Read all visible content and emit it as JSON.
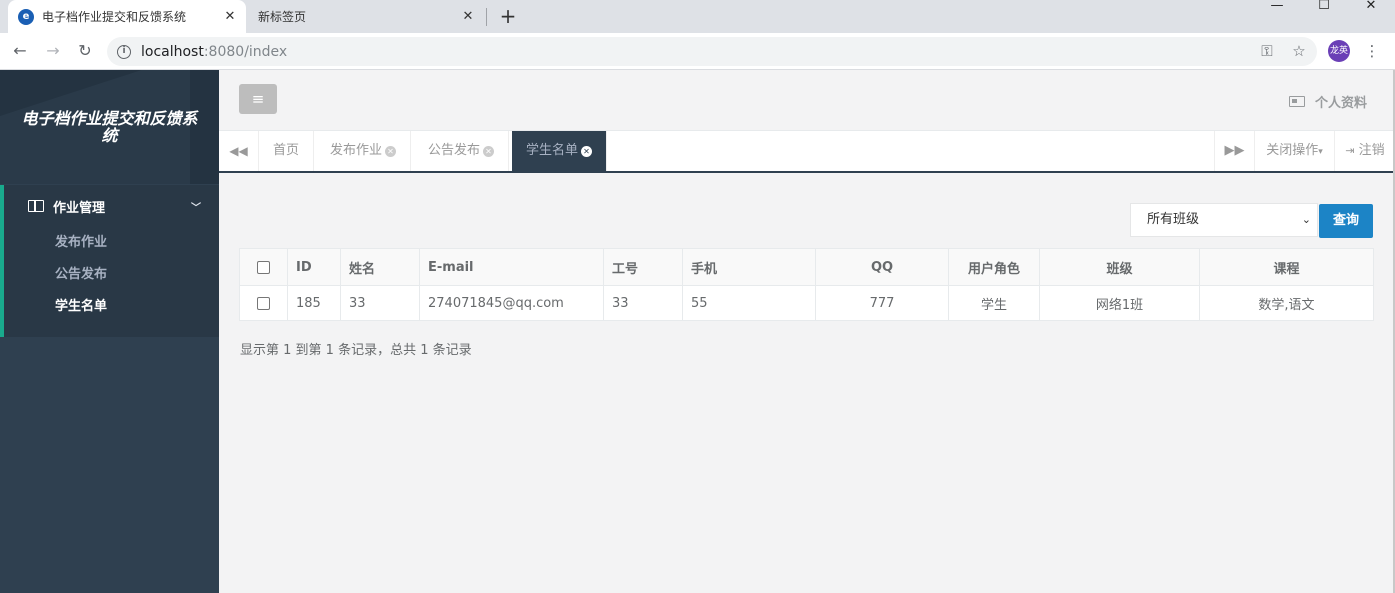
{
  "browser": {
    "tabs": [
      {
        "title": "电子档作业提交和反馈系统",
        "active": true
      },
      {
        "title": "新标签页",
        "active": false
      }
    ],
    "url_host": "localhost",
    "url_path": ":8080/index",
    "profile_text": "龙英"
  },
  "sidebar": {
    "brand": "电子档作业提交和反馈系统",
    "group_label": "作业管理",
    "items": [
      {
        "label": "发布作业"
      },
      {
        "label": "公告发布"
      },
      {
        "label": "学生名单"
      }
    ]
  },
  "topbar": {
    "profile_label": "个人资料"
  },
  "page_tabs": {
    "tabs": [
      {
        "label": "首页",
        "closable": false
      },
      {
        "label": "发布作业",
        "closable": true
      },
      {
        "label": "公告发布",
        "closable": true
      },
      {
        "label": "学生名单",
        "closable": true,
        "active": true
      }
    ],
    "close_ops_label": "关闭操作",
    "logout_label": "注销"
  },
  "filter": {
    "selected": "所有班级",
    "query_label": "查询"
  },
  "table": {
    "headers": [
      "ID",
      "姓名",
      "E-mail",
      "工号",
      "手机",
      "QQ",
      "用户角色",
      "班级",
      "课程"
    ],
    "rows": [
      [
        "185",
        "33",
        "274071845@qq.com",
        "33",
        "55",
        "777",
        "学生",
        "网络1班",
        "数学,语文"
      ]
    ]
  },
  "pagination": {
    "info": "显示第 1 到第 1 条记录，总共 1 条记录"
  },
  "colors": {
    "sidebar_bg": "#2f4050",
    "accent_green": "#19aa8d",
    "primary_blue": "#1c84c6"
  }
}
